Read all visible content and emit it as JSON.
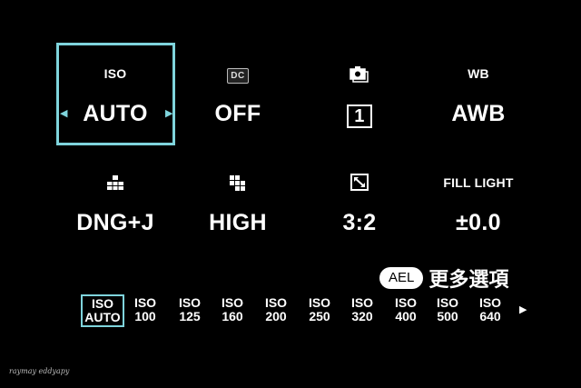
{
  "settings": [
    {
      "key": "iso",
      "label": "ISO",
      "value": "AUTO"
    },
    {
      "key": "drange",
      "label": "DC",
      "value": "OFF"
    },
    {
      "key": "drive",
      "label": "",
      "value": "1"
    },
    {
      "key": "wb",
      "label": "WB",
      "value": "AWB"
    },
    {
      "key": "quality",
      "label": "",
      "value": "DNG+J"
    },
    {
      "key": "size",
      "label": "",
      "value": "HIGH"
    },
    {
      "key": "aspect",
      "label": "",
      "value": "3:2"
    },
    {
      "key": "fill_light",
      "label": "FILL LIGHT",
      "value": "±0.0"
    }
  ],
  "ael": {
    "pill": "AEL",
    "text": "更多選項"
  },
  "iso_strip": [
    {
      "top": "ISO",
      "bottom": "AUTO",
      "selected": true
    },
    {
      "top": "ISO",
      "bottom": "100"
    },
    {
      "top": "ISO",
      "bottom": "125"
    },
    {
      "top": "ISO",
      "bottom": "160"
    },
    {
      "top": "ISO",
      "bottom": "200"
    },
    {
      "top": "ISO",
      "bottom": "250"
    },
    {
      "top": "ISO",
      "bottom": "320"
    },
    {
      "top": "ISO",
      "bottom": "400"
    },
    {
      "top": "ISO",
      "bottom": "500"
    },
    {
      "top": "ISO",
      "bottom": "640"
    }
  ],
  "watermark": "raymay eddyapy",
  "colors": {
    "accent": "#7fd4dc",
    "background": "#000000",
    "text": "#ffffff"
  },
  "icons": {
    "drive": "camera-stack-icon",
    "quality": "pixel-stack-icon",
    "size": "grid-icon",
    "aspect": "resize-icon"
  }
}
